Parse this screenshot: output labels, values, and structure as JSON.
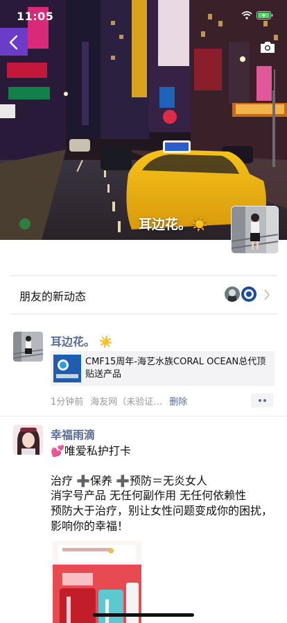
{
  "status_bar": {
    "time": "11:05"
  },
  "cover": {
    "user_name": "耳边花。",
    "sun_emoji": "☀️"
  },
  "new_updates": {
    "label": "朋友的新动态"
  },
  "posts": [
    {
      "author": "耳边花。",
      "emoji": "☀️",
      "share": {
        "title": "CMF15周年-海艺水族CORAL OCEAN总代顶贴送产品"
      },
      "time": "1分钟前",
      "source": "海友网（未验证…",
      "delete_label": "删除"
    },
    {
      "author": "幸福雨滴",
      "line1": "💕唯爱私护打卡",
      "line2": "治疗 ➕保养 ➕预防＝无炎女人",
      "line3": "消字号产品 无任何副作用 无任何依赖性",
      "line4": "预防大于治疗，别让女性问题变成你的困扰，影响你的幸福！"
    }
  ],
  "icons": [
    "back-icon",
    "camera-icon",
    "wifi-icon",
    "battery-icon",
    "chevron-right-icon",
    "more-icon"
  ],
  "colors": {
    "link_blue": "#576b95",
    "meta_gray": "#9a9a9a",
    "card_bg": "#f3f3f5"
  }
}
